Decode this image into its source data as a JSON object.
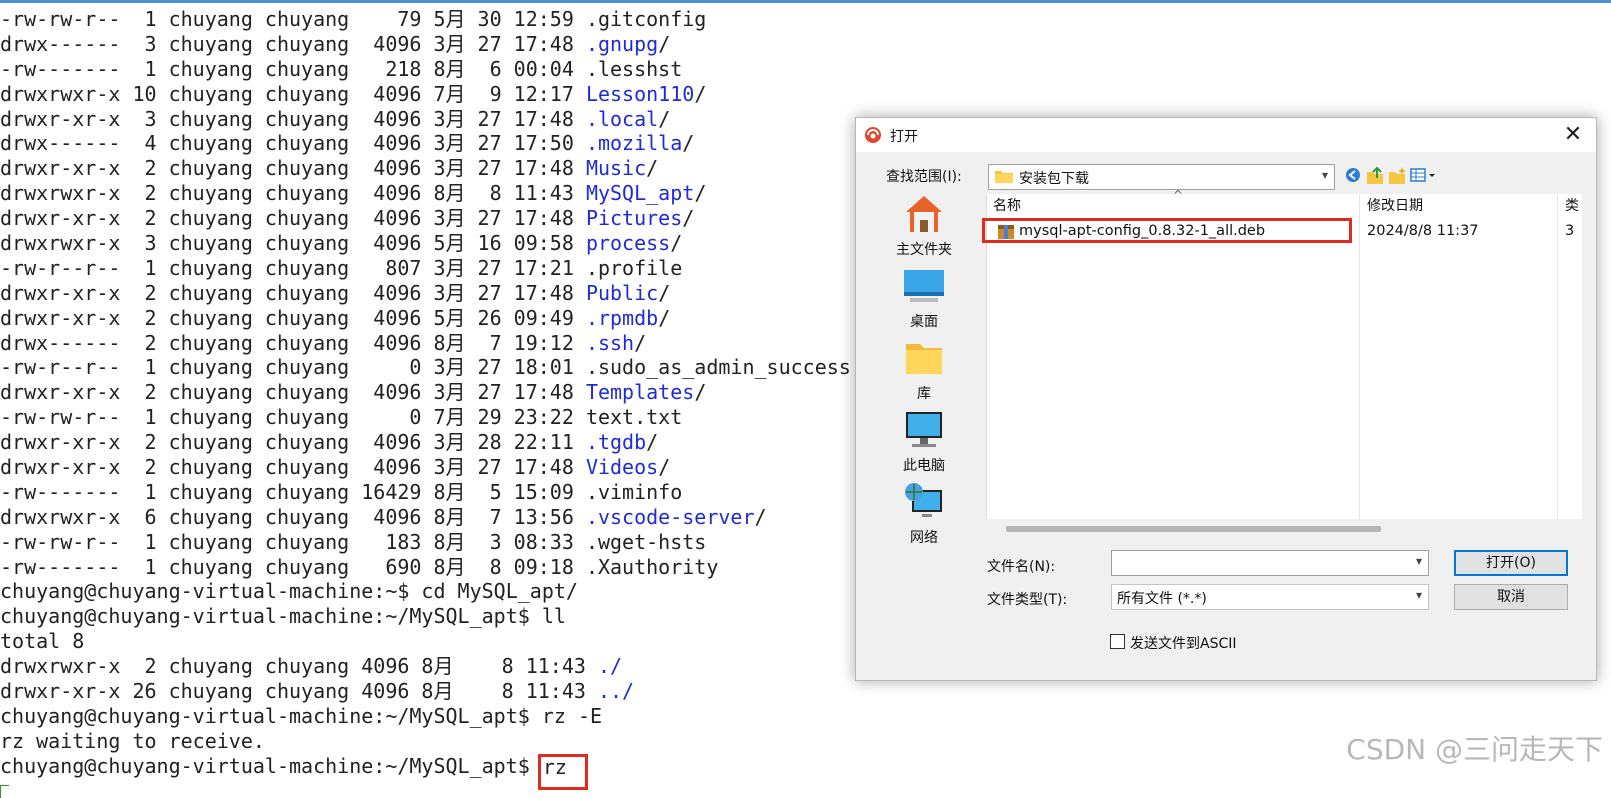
{
  "terminal": {
    "listing": [
      {
        "perms": "-rw-rw-r--",
        "links": " 1",
        "owner": "chuyang",
        "group": "chuyang",
        "size": "   79",
        "month": "5月",
        "day": "30",
        "time": "12:59",
        "name": ".gitconfig",
        "is_dir": false
      },
      {
        "perms": "drwx------",
        "links": " 3",
        "owner": "chuyang",
        "group": "chuyang",
        "size": " 4096",
        "month": "3月",
        "day": "27",
        "time": "17:48",
        "name": ".gnupg",
        "is_dir": true
      },
      {
        "perms": "-rw-------",
        "links": " 1",
        "owner": "chuyang",
        "group": "chuyang",
        "size": "  218",
        "month": "8月",
        "day": " 6",
        "time": "00:04",
        "name": ".lesshst",
        "is_dir": false
      },
      {
        "perms": "drwxrwxr-x",
        "links": "10",
        "owner": "chuyang",
        "group": "chuyang",
        "size": " 4096",
        "month": "7月",
        "day": " 9",
        "time": "12:17",
        "name": "Lesson110",
        "is_dir": true
      },
      {
        "perms": "drwxr-xr-x",
        "links": " 3",
        "owner": "chuyang",
        "group": "chuyang",
        "size": " 4096",
        "month": "3月",
        "day": "27",
        "time": "17:48",
        "name": ".local",
        "is_dir": true
      },
      {
        "perms": "drwx------",
        "links": " 4",
        "owner": "chuyang",
        "group": "chuyang",
        "size": " 4096",
        "month": "3月",
        "day": "27",
        "time": "17:50",
        "name": ".mozilla",
        "is_dir": true
      },
      {
        "perms": "drwxr-xr-x",
        "links": " 2",
        "owner": "chuyang",
        "group": "chuyang",
        "size": " 4096",
        "month": "3月",
        "day": "27",
        "time": "17:48",
        "name": "Music",
        "is_dir": true
      },
      {
        "perms": "drwxrwxr-x",
        "links": " 2",
        "owner": "chuyang",
        "group": "chuyang",
        "size": " 4096",
        "month": "8月",
        "day": " 8",
        "time": "11:43",
        "name": "MySQL_apt",
        "is_dir": true
      },
      {
        "perms": "drwxr-xr-x",
        "links": " 2",
        "owner": "chuyang",
        "group": "chuyang",
        "size": " 4096",
        "month": "3月",
        "day": "27",
        "time": "17:48",
        "name": "Pictures",
        "is_dir": true
      },
      {
        "perms": "drwxrwxr-x",
        "links": " 3",
        "owner": "chuyang",
        "group": "chuyang",
        "size": " 4096",
        "month": "5月",
        "day": "16",
        "time": "09:58",
        "name": "process",
        "is_dir": true
      },
      {
        "perms": "-rw-r--r--",
        "links": " 1",
        "owner": "chuyang",
        "group": "chuyang",
        "size": "  807",
        "month": "3月",
        "day": "27",
        "time": "17:21",
        "name": ".profile",
        "is_dir": false
      },
      {
        "perms": "drwxr-xr-x",
        "links": " 2",
        "owner": "chuyang",
        "group": "chuyang",
        "size": " 4096",
        "month": "3月",
        "day": "27",
        "time": "17:48",
        "name": "Public",
        "is_dir": true
      },
      {
        "perms": "drwxr-xr-x",
        "links": " 2",
        "owner": "chuyang",
        "group": "chuyang",
        "size": " 4096",
        "month": "5月",
        "day": "26",
        "time": "09:49",
        "name": ".rpmdb",
        "is_dir": true
      },
      {
        "perms": "drwx------",
        "links": " 2",
        "owner": "chuyang",
        "group": "chuyang",
        "size": " 4096",
        "month": "8月",
        "day": " 7",
        "time": "19:12",
        "name": ".ssh",
        "is_dir": true
      },
      {
        "perms": "-rw-r--r--",
        "links": " 1",
        "owner": "chuyang",
        "group": "chuyang",
        "size": "    0",
        "month": "3月",
        "day": "27",
        "time": "18:01",
        "name": ".sudo_as_admin_success",
        "is_dir": false
      },
      {
        "perms": "drwxr-xr-x",
        "links": " 2",
        "owner": "chuyang",
        "group": "chuyang",
        "size": " 4096",
        "month": "3月",
        "day": "27",
        "time": "17:48",
        "name": "Templates",
        "is_dir": true
      },
      {
        "perms": "-rw-rw-r--",
        "links": " 1",
        "owner": "chuyang",
        "group": "chuyang",
        "size": "    0",
        "month": "7月",
        "day": "29",
        "time": "23:22",
        "name": "text.txt",
        "is_dir": false
      },
      {
        "perms": "drwxr-xr-x",
        "links": " 2",
        "owner": "chuyang",
        "group": "chuyang",
        "size": " 4096",
        "month": "3月",
        "day": "28",
        "time": "22:11",
        "name": ".tgdb",
        "is_dir": true
      },
      {
        "perms": "drwxr-xr-x",
        "links": " 2",
        "owner": "chuyang",
        "group": "chuyang",
        "size": " 4096",
        "month": "3月",
        "day": "27",
        "time": "17:48",
        "name": "Videos",
        "is_dir": true
      },
      {
        "perms": "-rw-------",
        "links": " 1",
        "owner": "chuyang",
        "group": "chuyang",
        "size": "16429",
        "month": "8月",
        "day": " 5",
        "time": "15:09",
        "name": ".viminfo",
        "is_dir": false
      },
      {
        "perms": "drwxrwxr-x",
        "links": " 6",
        "owner": "chuyang",
        "group": "chuyang",
        "size": " 4096",
        "month": "8月",
        "day": " 7",
        "time": "13:56",
        "name": ".vscode-server",
        "is_dir": true
      },
      {
        "perms": "-rw-rw-r--",
        "links": " 1",
        "owner": "chuyang",
        "group": "chuyang",
        "size": "  183",
        "month": "8月",
        "day": " 3",
        "time": "08:33",
        "name": ".wget-hsts",
        "is_dir": false
      },
      {
        "perms": "-rw-------",
        "links": " 1",
        "owner": "chuyang",
        "group": "chuyang",
        "size": "  690",
        "month": "8月",
        "day": " 8",
        "time": "09:18",
        "name": ".Xauthority",
        "is_dir": false
      }
    ],
    "cmd1": "chuyang@chuyang-virtual-machine:~$ cd MySQL_apt/",
    "cmd2": "chuyang@chuyang-virtual-machine:~/MySQL_apt$ ll",
    "total": "total 8",
    "dot_entries": [
      {
        "prefix": "drwxrwxr-x  2 chuyang chuyang 4096 8月    8 11:43 ",
        "name": "./"
      },
      {
        "prefix": "drwxr-xr-x 26 chuyang chuyang 4096 8月    8 11:43 ",
        "name": "../"
      }
    ],
    "cmd3": "chuyang@chuyang-virtual-machine:~/MySQL_apt$ rz -E",
    "rz_wait": "rz waiting to receive.",
    "prompt_final": "chuyang@chuyang-virtual-machine:~/MySQL_apt$ ",
    "typed_final": "rz"
  },
  "dialog": {
    "title": "打开",
    "lookin_label": "查找范围(I):",
    "lookin_value": "安装包下载",
    "places": [
      {
        "label": "主文件夹",
        "icon": "home-icon"
      },
      {
        "label": "桌面",
        "icon": "desktop-icon"
      },
      {
        "label": "库",
        "icon": "library-folder-icon"
      },
      {
        "label": "此电脑",
        "icon": "computer-icon"
      },
      {
        "label": "网络",
        "icon": "network-icon"
      }
    ],
    "columns": {
      "name": "名称",
      "modified": "修改日期",
      "extra": "类"
    },
    "files": [
      {
        "name": "mysql-apt-config_0.8.32-1_all.deb",
        "modified": "2024/8/8 11:37",
        "extra": "3"
      }
    ],
    "filename_label": "文件名(N):",
    "filename_value": "",
    "filetype_label": "文件类型(T):",
    "filetype_value": "所有文件 (*.*)",
    "open_button": "打开(O)",
    "cancel_button": "取消",
    "ascii_label": "发送文件到ASCII",
    "ascii_checked": false
  },
  "watermark": "CSDN @三问走天下",
  "colors": {
    "dir_text": "#1f2bd6",
    "highlight": "#e02b20",
    "accent": "#0078d7"
  }
}
